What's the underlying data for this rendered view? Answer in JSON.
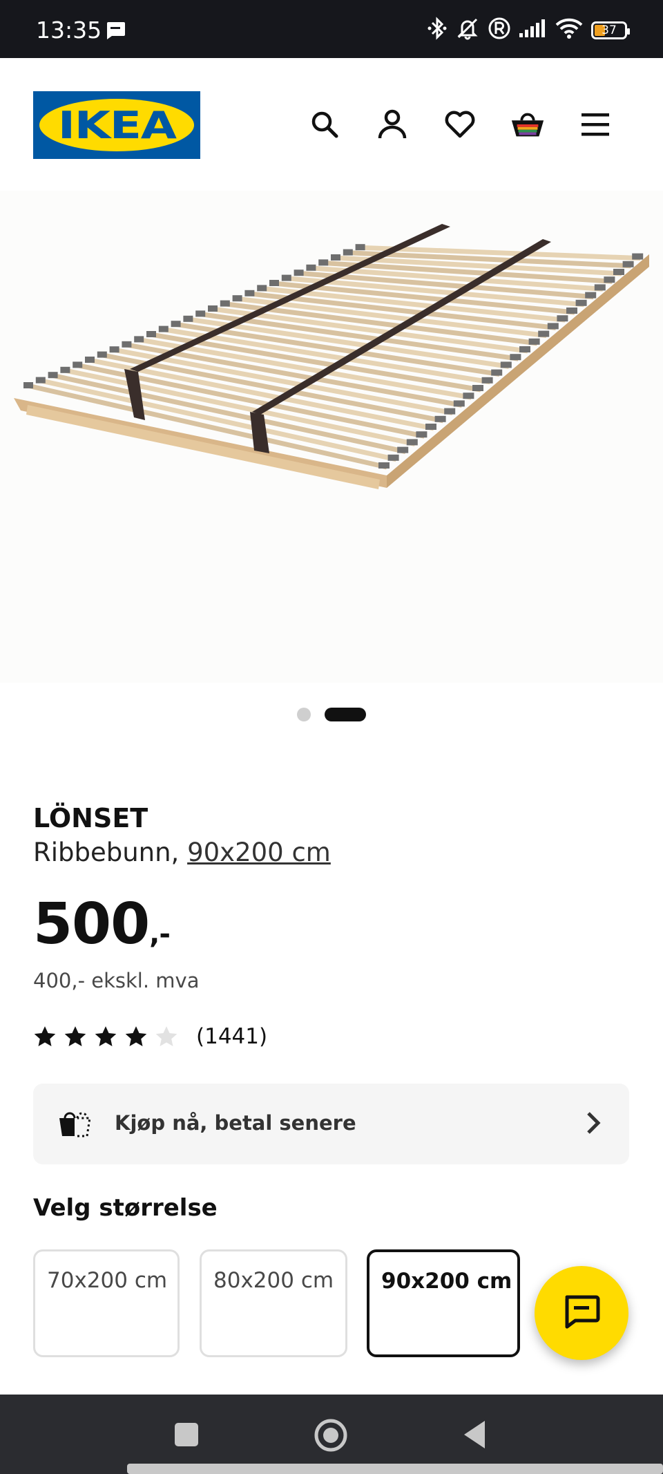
{
  "status_bar": {
    "time": "13:35",
    "battery": "37",
    "icons": [
      "message-icon",
      "bluetooth-icon",
      "bell-off-icon",
      "registered-icon",
      "signal-icon",
      "wifi-icon",
      "battery-icon"
    ]
  },
  "header": {
    "logo_text": "IKEA",
    "icons": [
      "search-icon",
      "account-icon",
      "heart-icon",
      "cart-icon",
      "menu-icon"
    ],
    "colors": {
      "logo_blue": "#0058a3",
      "logo_yellow": "#ffdb00"
    }
  },
  "gallery": {
    "image": "slatted-bed-base-image",
    "pagination": {
      "count": 2,
      "active": 2
    }
  },
  "product": {
    "name": "LÖNSET",
    "type": "Ribbebunn,",
    "size": "90x200 cm",
    "price": "500",
    "price_suffix": ",-",
    "price_ex_vat": "400,- ekskl. mva",
    "rating": {
      "value": 4,
      "max": 5,
      "count": "(1441)"
    }
  },
  "bnpl": {
    "label": "Kjøp nå, betal senere"
  },
  "size_selector": {
    "heading": "Velg størrelse",
    "options": [
      "70x200 cm",
      "80x200 cm",
      "90x200 cm"
    ],
    "selected_index": 2
  },
  "chat": {
    "icon": "chat-icon",
    "color": "#ffdb00"
  },
  "nav_bar": {
    "icons": [
      "recents-square-icon",
      "home-circle-icon",
      "back-triangle-icon"
    ]
  }
}
